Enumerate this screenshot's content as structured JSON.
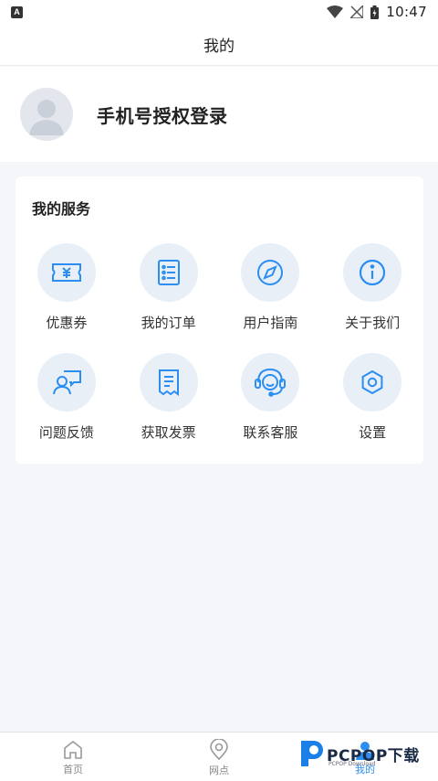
{
  "status_bar": {
    "time": "10:47",
    "left_badge": "A"
  },
  "header": {
    "title": "我的"
  },
  "profile": {
    "login_label": "手机号授权登录"
  },
  "services": {
    "title": "我的服务",
    "items": [
      {
        "label": "优惠券",
        "icon": "coupon-icon"
      },
      {
        "label": "我的订单",
        "icon": "order-list-icon"
      },
      {
        "label": "用户指南",
        "icon": "compass-icon"
      },
      {
        "label": "关于我们",
        "icon": "info-icon"
      },
      {
        "label": "问题反馈",
        "icon": "feedback-icon"
      },
      {
        "label": "获取发票",
        "icon": "invoice-icon"
      },
      {
        "label": "联系客服",
        "icon": "headset-icon"
      },
      {
        "label": "设置",
        "icon": "settings-hex-icon"
      }
    ]
  },
  "tabbar": {
    "tabs": [
      {
        "label": "首页",
        "icon": "home-icon"
      },
      {
        "label": "网点",
        "icon": "location-icon"
      },
      {
        "label": "我的",
        "icon": "user-icon",
        "active": true
      }
    ]
  },
  "watermark": {
    "brand": "PCPOP下载",
    "sub": "PCPOP Download"
  },
  "colors": {
    "accent": "#2b8ef0",
    "icon_bg": "#e9eff7",
    "page_bg": "#f5f6f9"
  }
}
